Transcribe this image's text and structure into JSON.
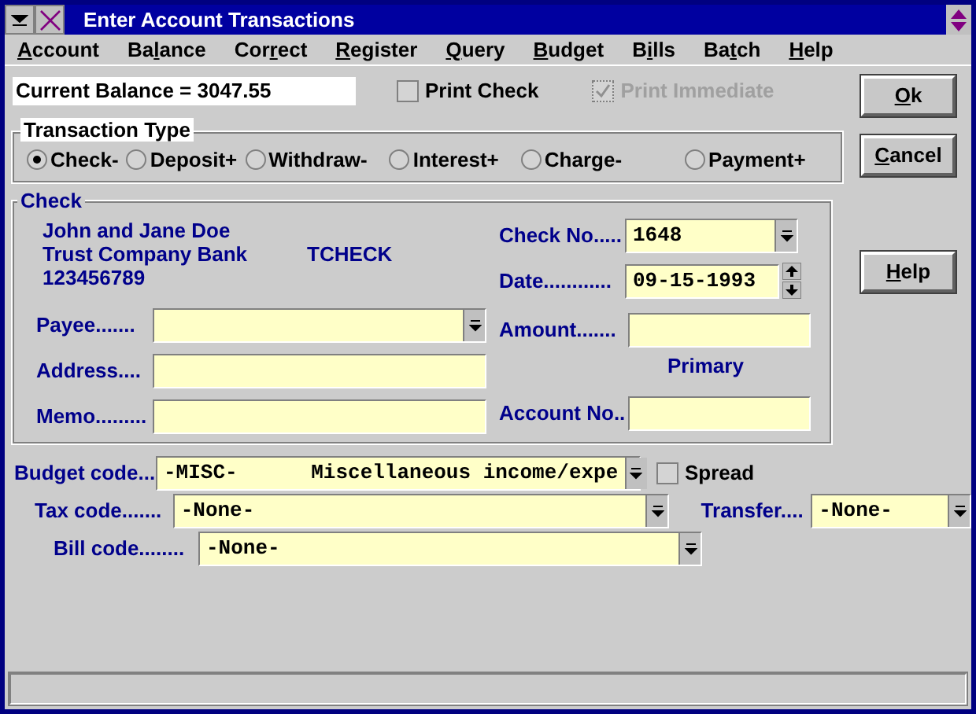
{
  "window": {
    "title": "Enter Account Transactions"
  },
  "menu": [
    {
      "key": "A",
      "after": "ccount"
    },
    {
      "before": "Ba",
      "key": "l",
      "after": "ance"
    },
    {
      "before": "Cor",
      "key": "r",
      "after": "ect"
    },
    {
      "key": "R",
      "after": "egister"
    },
    {
      "key": "Q",
      "after": "uery"
    },
    {
      "key": "B",
      "after": "udget"
    },
    {
      "before": "B",
      "key": "i",
      "after": "lls"
    },
    {
      "before": "Ba",
      "key": "t",
      "after": "ch"
    },
    {
      "key": "H",
      "after": "elp"
    }
  ],
  "balance": {
    "value": "Current Balance = 3047.55"
  },
  "options": [
    {
      "label": "Print Check",
      "checked": false,
      "disabled": false
    },
    {
      "label": "Print Immediate",
      "checked": true,
      "disabled": true
    }
  ],
  "buttons": [
    {
      "key": "O",
      "after": "k"
    },
    {
      "key": "C",
      "after": "ancel"
    },
    {
      "key": "H",
      "after": "elp"
    }
  ],
  "transaction_type": {
    "title": "Transaction Type",
    "options": [
      {
        "label": "Check-",
        "selected": true
      },
      {
        "label": "Deposit+",
        "selected": false
      },
      {
        "label": "Withdraw-",
        "selected": false
      },
      {
        "label": "Interest+",
        "selected": false
      },
      {
        "label": "Charge-",
        "selected": false
      },
      {
        "label": "Payment+",
        "selected": false
      }
    ]
  },
  "check": {
    "title": "Check",
    "owner": "John and Jane Doe",
    "bank": "Trust Company Bank",
    "account_code": "TCHECK",
    "routing": "123456789",
    "left_fields": [
      {
        "label": "Payee.......",
        "kind": "dropdown"
      },
      {
        "label": "Address...."
      },
      {
        "label": "Memo........."
      }
    ],
    "check_no": {
      "label": "Check No.....",
      "kind": "dropdown",
      "value": "1648"
    },
    "date": {
      "label": "Date............",
      "kind": "spinner",
      "value": "09-15-1993"
    },
    "amount": {
      "label": "Amount......."
    },
    "primary": "Primary",
    "account_no": {
      "label": "Account No.."
    }
  },
  "budget_code": {
    "label": "Budget code...",
    "value": "-MISC-      Miscellaneous income/expe"
  },
  "spread": {
    "label": "Spread",
    "checked": false
  },
  "tax_code": {
    "label": "Tax code.......",
    "value": "-None-"
  },
  "transfer": {
    "label": "Transfer....",
    "value": "-None-"
  },
  "bill_code": {
    "label": "Bill code........",
    "value": "-None-"
  }
}
